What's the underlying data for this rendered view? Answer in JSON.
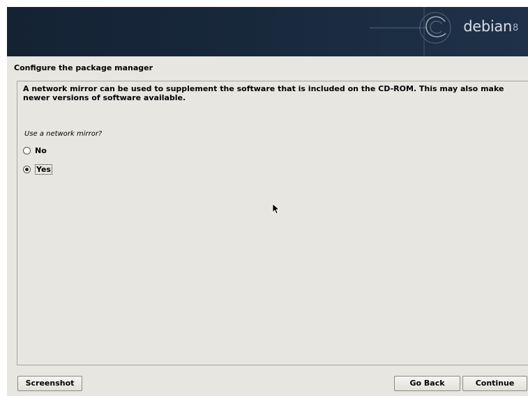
{
  "banner": {
    "brand_name": "debian",
    "brand_version": "8"
  },
  "step": {
    "title": "Configure the package manager"
  },
  "content": {
    "description": "A network mirror can be used to supplement the software that is included on the CD-ROM. This may also make newer versions of software available.",
    "question": "Use a network mirror?",
    "options": [
      {
        "label": "No",
        "selected": false
      },
      {
        "label": "Yes",
        "selected": true
      }
    ]
  },
  "buttons": {
    "screenshot": "Screenshot",
    "go_back": "Go Back",
    "continue": "Continue"
  },
  "colors": {
    "banner": "#18283b",
    "background": "#e8e6e1",
    "text": "#000000"
  }
}
